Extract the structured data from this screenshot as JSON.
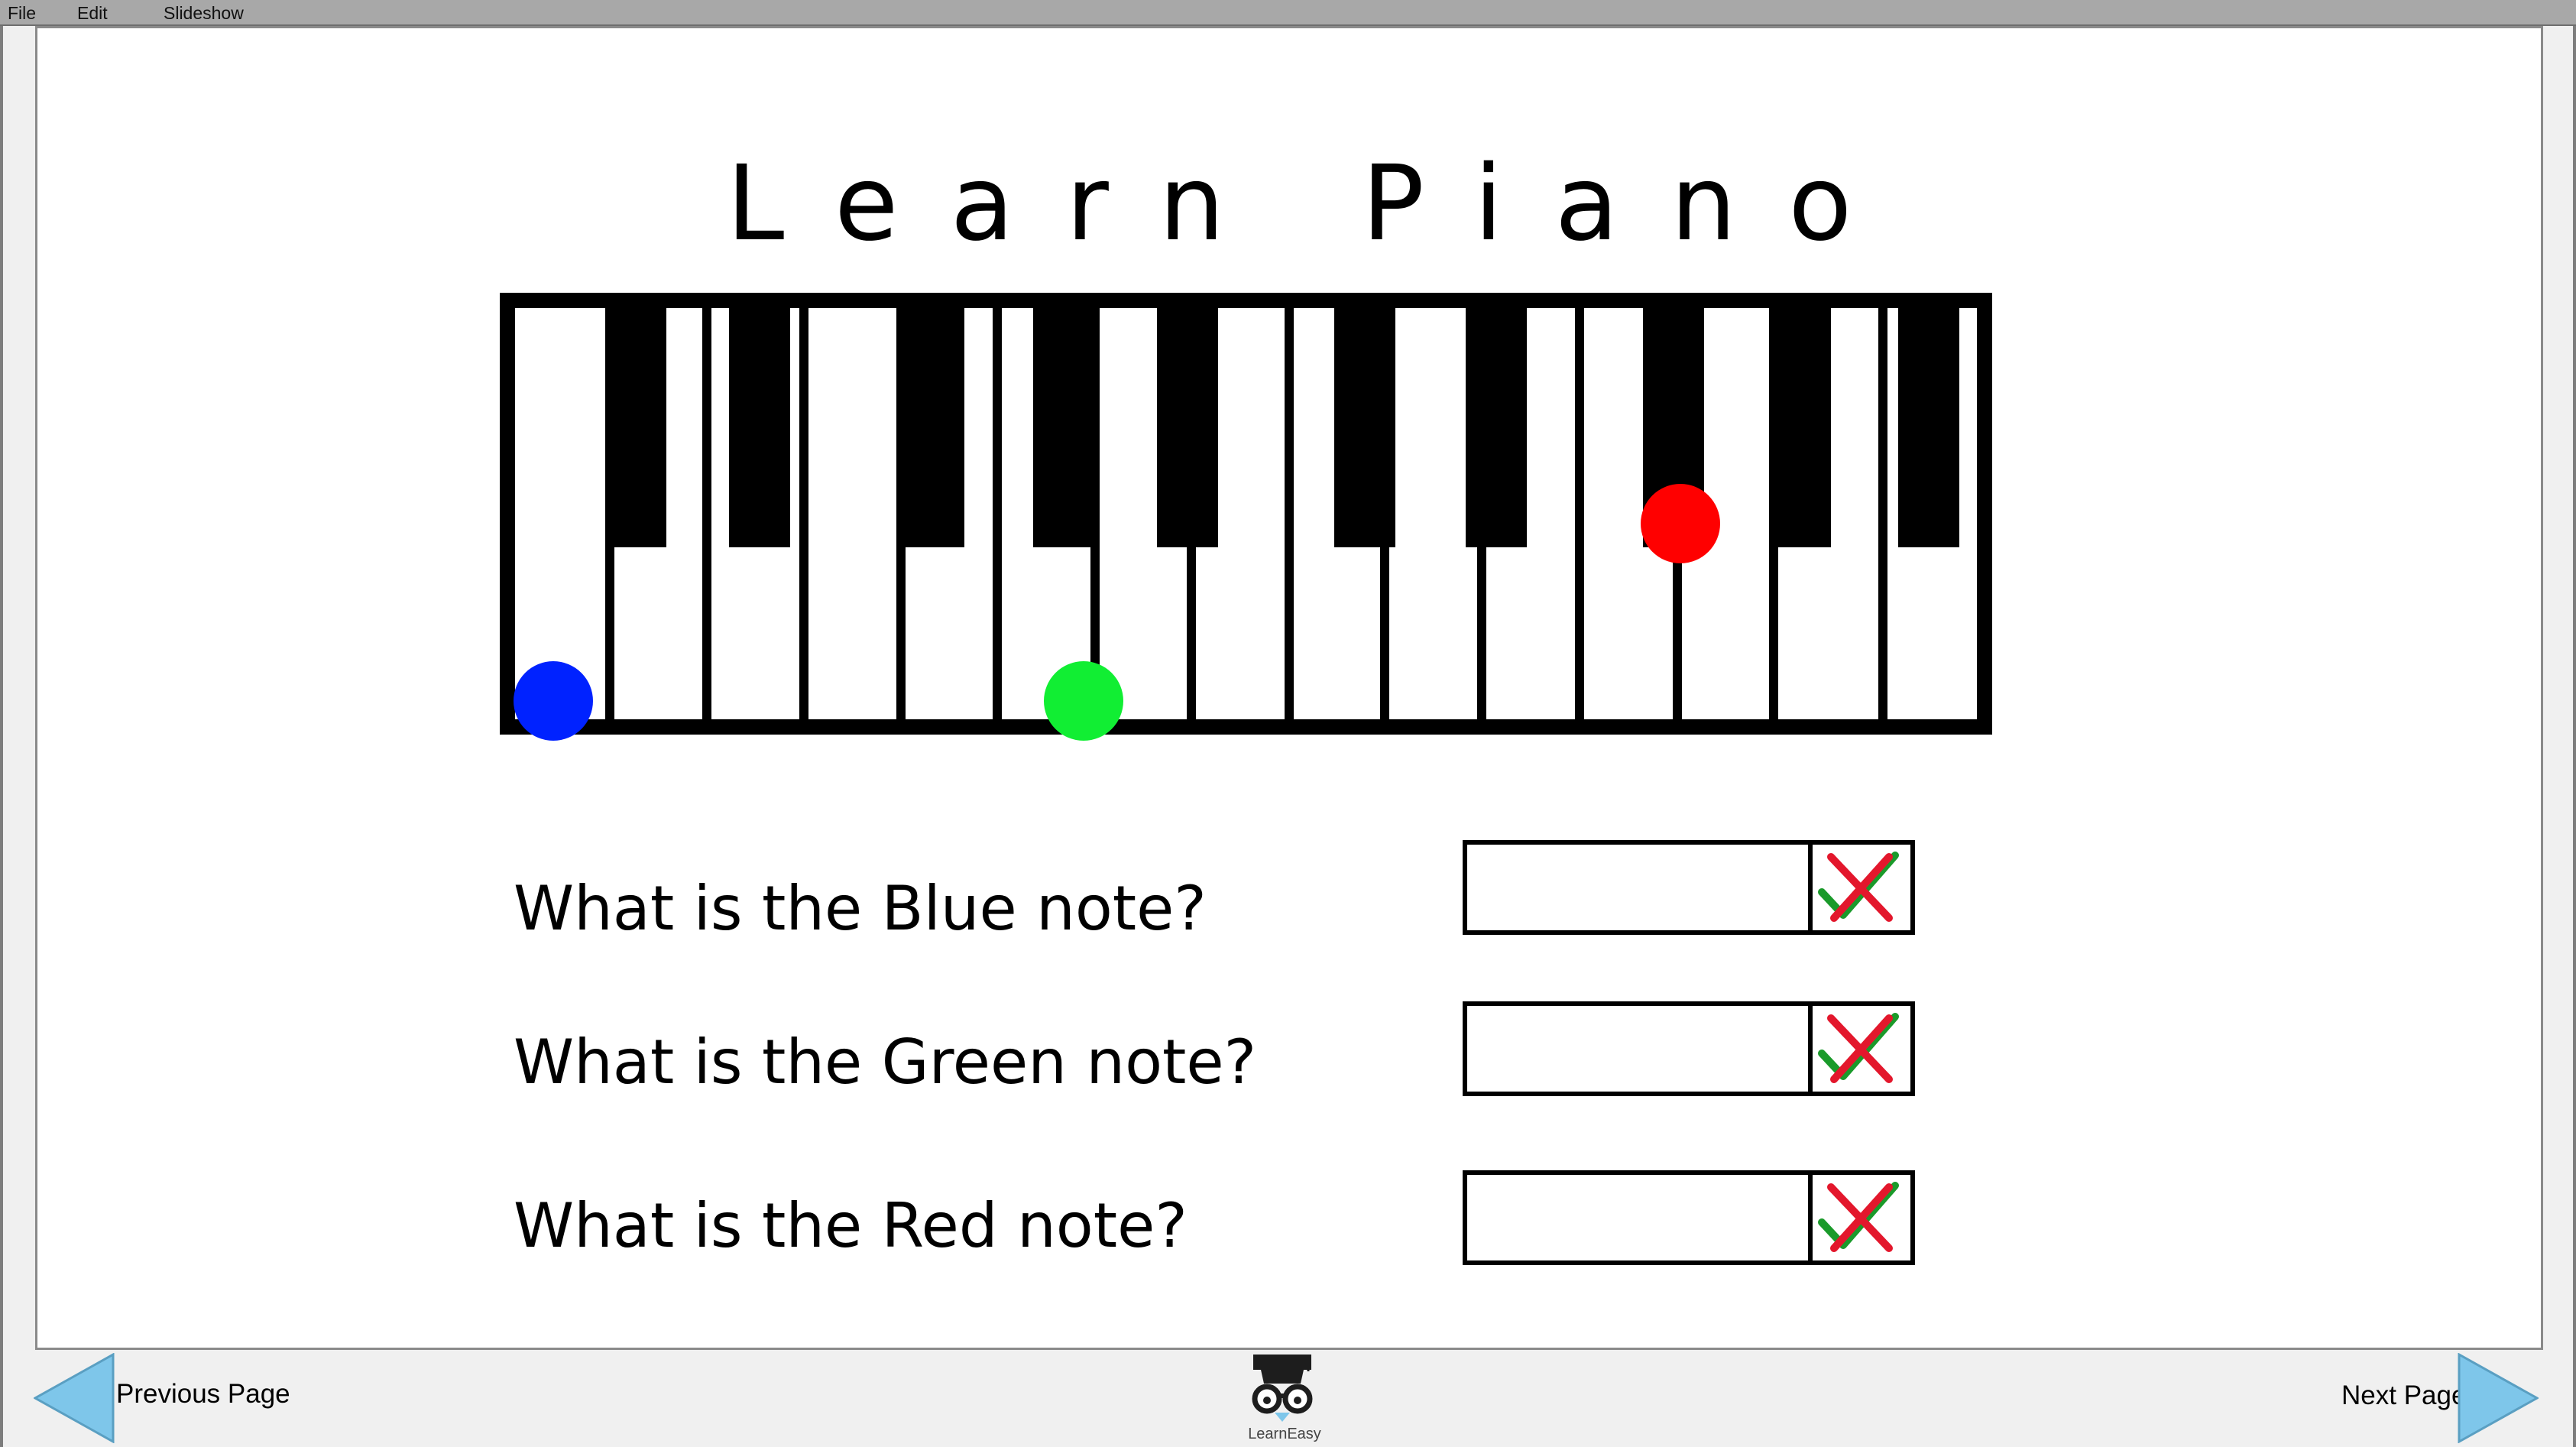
{
  "menu": {
    "items": [
      "File",
      "Edit",
      "Slideshow"
    ]
  },
  "slide": {
    "title": "Learn Piano",
    "questions": [
      {
        "label": "What is the Blue note?",
        "answer": "",
        "color": "#0022ff"
      },
      {
        "label": "What is the Green note?",
        "answer": "",
        "color": "#11ee33"
      },
      {
        "label": "What is the Red note?",
        "answer": "",
        "color": "#ff0000"
      }
    ]
  },
  "keyboard": {
    "white_keys": 14,
    "colors": {
      "blue": "#0022ff",
      "green": "#11ee33",
      "red": "#ff0000"
    }
  },
  "navigation": {
    "previous_label": "Previous Page",
    "next_label": "Next Page",
    "logo_text": "LearnEasy",
    "accent": "#7ec6ea"
  }
}
